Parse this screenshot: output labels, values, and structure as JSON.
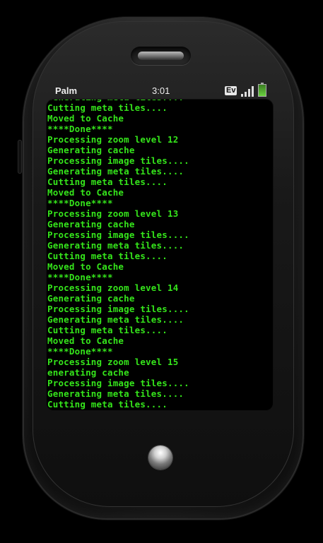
{
  "status_bar": {
    "carrier": "Palm",
    "time": "3:01",
    "network_badge": "Ev",
    "signal_bars": 4,
    "battery_level": 1.0
  },
  "terminal": {
    "lines": [
      "Generating meta tiles....",
      "Cutting meta tiles....",
      "Moved to Cache",
      "****Done****",
      "Processing zoom level 12",
      "Generating cache",
      "Processing image tiles....",
      "Generating meta tiles....",
      "Cutting meta tiles....",
      "Moved to Cache",
      "****Done****",
      "Processing zoom level 13",
      "Generating cache",
      "Processing image tiles....",
      "Generating meta tiles....",
      "Cutting meta tiles....",
      "Moved to Cache",
      "****Done****",
      "Processing zoom level 14",
      "Generating cache",
      "Processing image tiles....",
      "Generating meta tiles....",
      "Cutting meta tiles....",
      "Moved to Cache",
      "****Done****",
      "Processing zoom level 15",
      "enerating cache",
      "Processing image tiles....",
      "Generating meta tiles....",
      "Cutting meta tiles...."
    ]
  },
  "colors": {
    "terminal_text": "#35e51b",
    "screen_background": "#000000",
    "device_body": "#1a1a1a"
  },
  "icons": {
    "signal": "signal-strength-icon",
    "battery": "battery-icon",
    "earpiece": "earpiece-speaker-icon",
    "home": "home-button-icon"
  }
}
